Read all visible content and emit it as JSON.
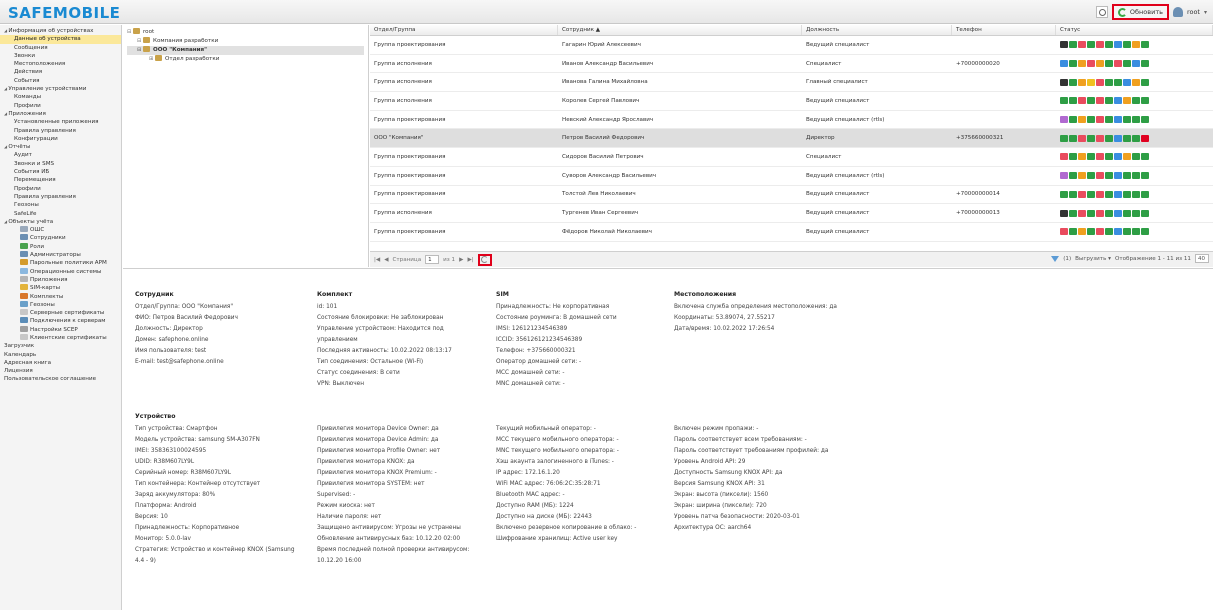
{
  "header": {
    "logo": "SAFEMOBILE",
    "refresh_label": "Обновить",
    "user": "root"
  },
  "sidebar": [
    {
      "label": "Информация об устройствах",
      "level": 0,
      "group": true
    },
    {
      "label": "Данные об устройства",
      "level": 1,
      "selected": true
    },
    {
      "label": "Сообщения",
      "level": 1
    },
    {
      "label": "Звонки",
      "level": 1
    },
    {
      "label": "Местоположения",
      "level": 1
    },
    {
      "label": "Действия",
      "level": 1
    },
    {
      "label": "События",
      "level": 1
    },
    {
      "label": "Управление устройствами",
      "level": 0,
      "group": true
    },
    {
      "label": "Команды",
      "level": 1
    },
    {
      "label": "Профили",
      "level": 1
    },
    {
      "label": "Приложения",
      "level": 0,
      "group": true
    },
    {
      "label": "Установленные приложения",
      "level": 1
    },
    {
      "label": "Правила управления",
      "level": 1
    },
    {
      "label": "Конфигурации",
      "level": 1
    },
    {
      "label": "Отчёты",
      "level": 0,
      "group": true
    },
    {
      "label": "Аудит",
      "level": 1
    },
    {
      "label": "Звонки и SMS",
      "level": 1
    },
    {
      "label": "События ИБ",
      "level": 1
    },
    {
      "label": "Перемещения",
      "level": 1
    },
    {
      "label": "Профили",
      "level": 1
    },
    {
      "label": "Правила управления",
      "level": 1
    },
    {
      "label": "Геозоны",
      "level": 1
    },
    {
      "label": "SafeLife",
      "level": 1
    },
    {
      "label": "Объекты учёта",
      "level": 0,
      "group": true
    },
    {
      "label": "ОШС",
      "level": 2,
      "icon": "#9aa9bb"
    },
    {
      "label": "Сотрудники",
      "level": 2,
      "icon": "#6b8fb3"
    },
    {
      "label": "Роли",
      "level": 2,
      "icon": "#4aa34f"
    },
    {
      "label": "Администраторы",
      "level": 2,
      "icon": "#6b8fb3"
    },
    {
      "label": "Парольные политики АРМ",
      "level": 2,
      "icon": "#d49b2c"
    },
    {
      "label": "Операционные системы",
      "level": 2,
      "icon": "#8bb8df"
    },
    {
      "label": "Приложения",
      "level": 2,
      "icon": "#b5b5b5"
    },
    {
      "label": "SIM-карты",
      "level": 2,
      "icon": "#e3b33a"
    },
    {
      "label": "Комплекты",
      "level": 2,
      "icon": "#d9772b"
    },
    {
      "label": "Геозоны",
      "level": 2,
      "icon": "#6aa0c9"
    },
    {
      "label": "Серверные сертификаты",
      "level": 2,
      "icon": "#c7c7c7"
    },
    {
      "label": "Подключения к серверам",
      "level": 2,
      "icon": "#5b8db8"
    },
    {
      "label": "Настройки SCEP",
      "level": 2,
      "icon": "#a0a0a0"
    },
    {
      "label": "Клиентские сертификаты",
      "level": 2,
      "icon": "#c7c7c7"
    },
    {
      "label": "Загрузчик",
      "level": 0
    },
    {
      "label": "Календарь",
      "level": 0
    },
    {
      "label": "Адресная книга",
      "level": 0
    },
    {
      "label": "Лицензия",
      "level": 0
    },
    {
      "label": "Пользовательское соглашение",
      "level": 0
    }
  ],
  "tree": [
    {
      "label": "root",
      "level": 0
    },
    {
      "label": "Компания разработки",
      "level": 1
    },
    {
      "label": "ООО \"Компания\"",
      "level": 1,
      "selected": true
    },
    {
      "label": "Отдел разработки",
      "level": 2
    }
  ],
  "grid": {
    "columns": [
      "Отдел/Группа",
      "Сотрудник ▲",
      "Должность",
      "Телефон",
      "Статус"
    ],
    "rows": [
      {
        "group": "Группа проектирования",
        "employee": "Гагарин Юрий Алексеевич",
        "position": "Ведущий специалист",
        "phone": ""
      },
      {
        "group": "Группа исполнения",
        "employee": "Иванов Александр Васильевич",
        "position": "Специалист",
        "phone": "+70000000020"
      },
      {
        "group": "Группа исполнения",
        "employee": "Иванова Галина Михайловна",
        "position": "Главный специалист",
        "phone": ""
      },
      {
        "group": "Группа исполнения",
        "employee": "Королев Сергей Павлович",
        "position": "Ведущий специалист",
        "phone": ""
      },
      {
        "group": "Группа проектирования",
        "employee": "Невский Александр Ярославич",
        "position": "Ведущий специалист (rtls)",
        "phone": ""
      },
      {
        "group": "ООО \"Компания\"",
        "employee": "Петров Василий Федорович",
        "position": "Директор",
        "phone": "+375660000321",
        "selected": true
      },
      {
        "group": "Группа проектирования",
        "employee": "Сидоров Василий Петрович",
        "position": "Специалист",
        "phone": ""
      },
      {
        "group": "Группа проектирования",
        "employee": "Суворов Александр Васильевич",
        "position": "Ведущий специалист (rtls)",
        "phone": ""
      },
      {
        "group": "Группа проектирования",
        "employee": "Толстой Лев Николаевич",
        "position": "Ведущий специалист",
        "phone": "+70000000014"
      },
      {
        "group": "Группа исполнения",
        "employee": "Тургенев Иван Сергеевич",
        "position": "Ведущий специалист",
        "phone": "+70000000013"
      },
      {
        "group": "Группа проектирования",
        "employee": "Фёдоров Николай Николаевич",
        "position": "Ведущий специалист",
        "phone": ""
      }
    ],
    "footer": {
      "page_label": "Страница",
      "page_value": "1",
      "of_label": "из 1",
      "filter_count": "(1)",
      "export_label": "Выгрузить ▾",
      "display_label": "Отображение 1 - 11 из 11",
      "per_page": "40"
    }
  },
  "details": {
    "employee": {
      "title": "Сотрудник",
      "lines": [
        "Отдел/Группа: ООО \"Компания\"",
        "ФИО: Петров Василий Федорович",
        "Должность: Директор",
        "Домен: safephone.online",
        "Имя пользователя: test",
        "E-mail: test@safephone.online"
      ]
    },
    "kit": {
      "title": "Комплект",
      "lines": [
        "id: 101",
        "Состояние блокировки: Не заблокирован",
        "Управление устройством: Находится под",
        "управлением",
        "Последняя активность: 10.02.2022 08:13:17",
        "Тип соединения: Остальное (Wi-Fi)",
        "Статус соединения: В сети",
        "VPN: Выключен"
      ]
    },
    "sim": {
      "title": "SIM",
      "lines": [
        "Принадлежность: Не корпоративная",
        "Состояние роуминга: В домашней сети",
        "IMSI: 126121234546389",
        "ICCID: 356126121234546389",
        "Телефон: +375660000321",
        "Оператор домашней сети: -",
        "MCC домашней сети: -",
        "MNC домашней сети: -"
      ]
    },
    "location": {
      "title": "Местоположения",
      "lines": [
        "Включена служба определения местоположения: да",
        "Координаты: 53.89074, 27.55217",
        "Дата/время: 10.02.2022 17:26:54"
      ]
    },
    "device": {
      "title": "Устройство",
      "col1": [
        "Тип устройства: Смартфон",
        "Модель устройства: samsung SM-A307FN",
        "IMEI: 358363100024595",
        "UDID: R38M607LY9L",
        "Серийный номер: R38M607LY9L",
        "Тип контейнера: Контейнер отсутствует",
        "Заряд аккумулятора: 80%",
        "Платформа: Android",
        "Версия: 10",
        "Принадлежность: Корпоративное",
        "Монитор: 5.0.0-lav",
        "Стратегия: Устройство и контейнер KNOX (Samsung",
        "4.4 - 9)"
      ],
      "col2": [
        "Привилегия монитора Device Owner: да",
        "Привилегия монитора Device Admin: да",
        "Привилегия монитора Profile Owner: нет",
        "Привилегия монитора KNOX: да",
        "Привилегия монитора KNOX Premium: -",
        "Привилегия монитора SYSTEM: нет",
        "Supervised: -",
        "Режим киоска: нет",
        "Наличие пароля: нет",
        "Защищено антивирусом: Угрозы не устранены",
        "Обновление антивирусных баз: 10.12.20 02:00",
        "Время последней полной проверки антивирусом:",
        "10.12.20 16:00"
      ],
      "col3": [
        "Текущий мобильный оператор: -",
        "MCC текущего мобильного оператора: -",
        "MNC текущего мобильного оператора: -",
        "Хэш акаунта залогиненного в iTunes: -",
        "IP адрес: 172.16.1.20",
        "WiFi MAC адрес: 76:06:2C:35:28:71",
        "Bluetooth MAC адрес: -",
        "Доступно RAM (МБ): 1224",
        "Доступно на диске (МБ): 22443",
        "Включено резервное копирование в облако: -",
        "Шифрование хранилищ: Active user key"
      ],
      "col4": [
        "Включен режим пропажи: -",
        "Пароль соответствует всем требованиям: -",
        "Пароль соответствует требованиям профилей: да",
        "Уровень Android API: 29",
        "Доступность Samsung KNOX API: да",
        "Версия Samsung KNOX API: 31",
        "Экран: высота (пиксели): 1560",
        "Экран: ширина (пиксели): 720",
        "Уровень патча безопасности: 2020-03-01",
        "Архитектура ОС: aarch64"
      ]
    }
  },
  "status_palettes": [
    [
      "#333333",
      "#2e9e45",
      "#e94c5e",
      "#2e9e45",
      "#e94c5e",
      "#2e9e45",
      "#3a8ee0",
      "#2e9e45",
      "#f0a020",
      "#2e9e45"
    ],
    [
      "#3a8ee0",
      "#2e9e45",
      "#f0a020",
      "#e94c5e",
      "#f0a020",
      "#2e9e45",
      "#e94c5e",
      "#2e9e45",
      "#3a8ee0",
      "#2e9e45"
    ],
    [
      "#333333",
      "#2e9e45",
      "#f0a020",
      "#f0c020",
      "#e94c5e",
      "#2e9e45",
      "#2e9e45",
      "#3a8ee0",
      "#f0a020",
      "#2e9e45"
    ],
    [
      "#2e9e45",
      "#2e9e45",
      "#e94c5e",
      "#2e9e45",
      "#e94c5e",
      "#2e9e45",
      "#3a8ee0",
      "#f0a020",
      "#2e9e45",
      "#2e9e45"
    ],
    [
      "#b06ad0",
      "#2e9e45",
      "#f0a020",
      "#2e9e45",
      "#e94c5e",
      "#2e9e45",
      "#3a8ee0",
      "#2e9e45",
      "#2e9e45",
      "#2e9e45"
    ],
    [
      "#2e9e45",
      "#2e9e45",
      "#e94c5e",
      "#2e9e45",
      "#e94c5e",
      "#2e9e45",
      "#3a8ee0",
      "#2e9e45",
      "#2e9e45",
      "#e00020"
    ],
    [
      "#e94c5e",
      "#2e9e45",
      "#f0a020",
      "#2e9e45",
      "#e94c5e",
      "#2e9e45",
      "#3a8ee0",
      "#f0a020",
      "#2e9e45",
      "#2e9e45"
    ],
    [
      "#b06ad0",
      "#2e9e45",
      "#f0a020",
      "#2e9e45",
      "#e94c5e",
      "#2e9e45",
      "#3a8ee0",
      "#2e9e45",
      "#2e9e45",
      "#2e9e45"
    ],
    [
      "#2e9e45",
      "#2e9e45",
      "#e94c5e",
      "#2e9e45",
      "#e94c5e",
      "#2e9e45",
      "#3a8ee0",
      "#2e9e45",
      "#2e9e45",
      "#2e9e45"
    ],
    [
      "#333333",
      "#2e9e45",
      "#e94c5e",
      "#2e9e45",
      "#e94c5e",
      "#2e9e45",
      "#3a8ee0",
      "#2e9e45",
      "#2e9e45",
      "#2e9e45"
    ],
    [
      "#e94c5e",
      "#2e9e45",
      "#f0a020",
      "#2e9e45",
      "#e94c5e",
      "#2e9e45",
      "#3a8ee0",
      "#2e9e45",
      "#2e9e45",
      "#2e9e45"
    ]
  ]
}
